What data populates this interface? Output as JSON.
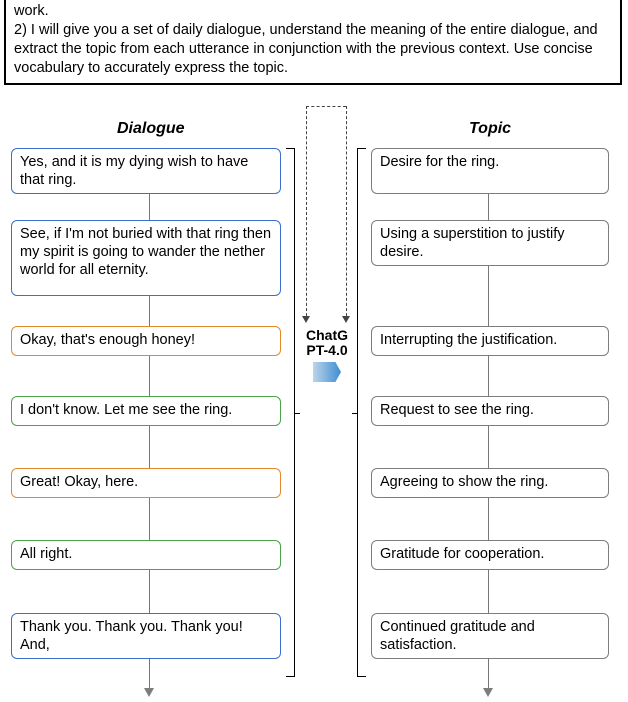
{
  "prompt": {
    "line1": "work.",
    "line2": "2) I will give you a set of daily dialogue, understand the meaning of the entire dialogue, and extract the topic from each utterance in conjunction with the previous context. Use concise vocabulary to accurately express the topic."
  },
  "headings": {
    "dialogue": "Dialogue",
    "topic": "Topic"
  },
  "model": {
    "name": "ChatG\nPT-4.0"
  },
  "colors": {
    "blue": "#3b6fc9",
    "orange": "#e08a2d",
    "green": "#4aa24a",
    "grey": "#7d7d7d"
  },
  "dialogue": [
    {
      "color": "blue",
      "text": "Yes, and it is my dying wish to have that ring."
    },
    {
      "color": "blue",
      "text": "See, if I'm not buried with that ring then my spirit is going to wander the nether world for all eternity."
    },
    {
      "color": "orange",
      "text": "Okay, that's enough honey!"
    },
    {
      "color": "green",
      "text": "I don't know.  Let me see the ring."
    },
    {
      "color": "orange",
      "text": "Great! Okay, here."
    },
    {
      "color": "green",
      "text": "All right."
    },
    {
      "color": "blue",
      "text": "Thank you. Thank you. Thank you! And,"
    }
  ],
  "topics": [
    "Desire for the ring.",
    "Using a superstition to justify desire.",
    "Interrupting the justification.",
    "Request to see the ring.",
    "Agreeing to show the ring.",
    "Gratitude for cooperation.",
    "Continued gratitude and satisfaction."
  ]
}
